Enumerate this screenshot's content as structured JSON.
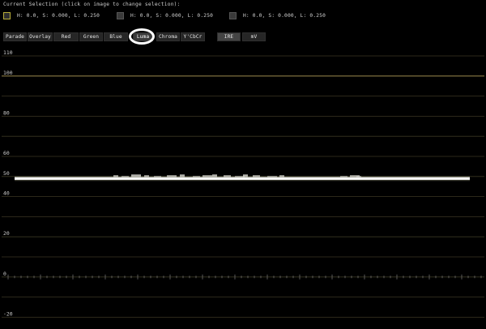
{
  "header": {
    "selection_title": "Current Selection (click on image to change selection):"
  },
  "swatches": [
    {
      "label": "H: 0.0, S: 0.000, L: 0.250",
      "selected": true
    },
    {
      "label": "H: 0.0, S: 0.000, L: 0.250",
      "selected": false
    },
    {
      "label": "H: 0.0, S: 0.000, L: 0.250",
      "selected": false
    }
  ],
  "modes": {
    "parade": "Parade",
    "overlay": "Overlay",
    "red": "Red",
    "green": "Green",
    "blue": "Blue",
    "luma": "Luma",
    "chroma": "Chroma",
    "ycbcr": "Y'CbCr",
    "active": "Luma"
  },
  "units": {
    "ire": "IRE",
    "mv": "mV",
    "active": "IRE"
  },
  "scope": {
    "y_labels": [
      "110",
      "100",
      "80",
      "60",
      "50",
      "40",
      "20",
      "0",
      "-20"
    ],
    "trace_level_ire": 49,
    "colors": {
      "background": "#000000",
      "gridline": "#3b3623",
      "limit_line": "#8a7a45",
      "trace": "#ffffff"
    }
  }
}
